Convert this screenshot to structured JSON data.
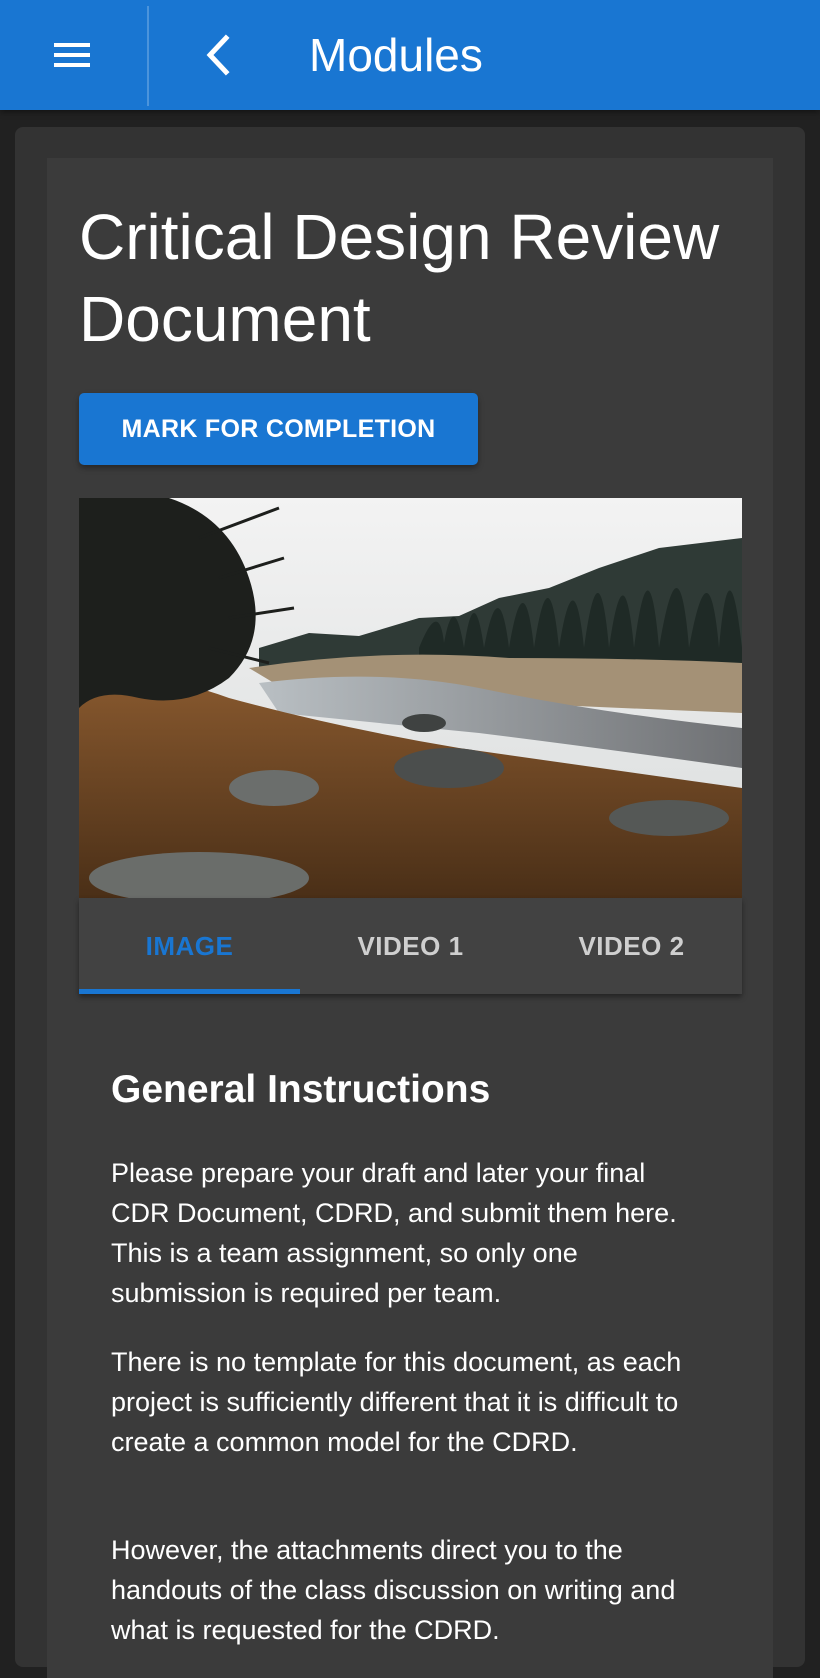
{
  "appbar": {
    "title": "Modules",
    "menu_icon": "hamburger-menu-icon",
    "back_icon": "chevron-left-icon",
    "color": "#1976d2"
  },
  "module": {
    "title": "Critical Design Review Document",
    "mark_button_label": "MARK FOR COMPLETION",
    "image_alt": "lake shore landscape photo"
  },
  "tabs": [
    {
      "label": "IMAGE",
      "active": true
    },
    {
      "label": "VIDEO 1",
      "active": false
    },
    {
      "label": "VIDEO 2",
      "active": false
    }
  ],
  "instructions": {
    "heading": "General Instructions",
    "paragraphs": [
      "Please prepare your draft and later your final CDR Document, CDRD, and submit them here. This is a team assignment, so only one submission is required per team.",
      "There is no template for this document, as each project is sufficiently different that it is difficult to create a common model for the CDRD.",
      "However, the attachments direct you to the handouts of the class discussion on writing and what is requested for the CDRD."
    ]
  },
  "colors": {
    "accent": "#1976d2",
    "background": "#212121",
    "card": "#3b3b3b"
  }
}
